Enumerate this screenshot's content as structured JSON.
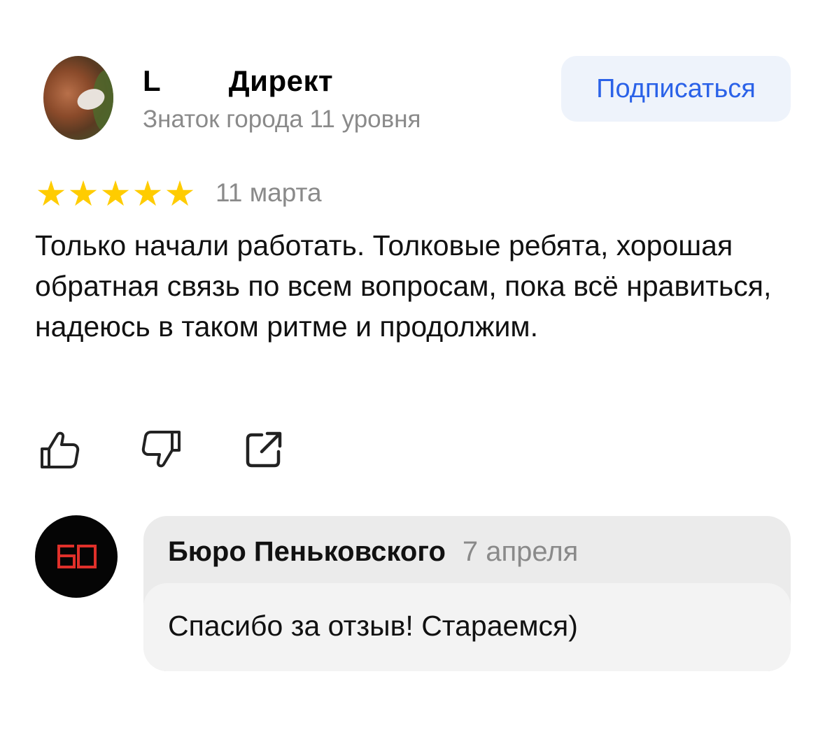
{
  "author": {
    "name": "L        Директ",
    "level": "Знаток города 11 уровня"
  },
  "subscribe_label": "Подписаться",
  "review": {
    "rating": 5,
    "rating_max": 5,
    "date": "11 марта",
    "text": "Только начали работать. Толковые ребята, хорошая обратная связь по всем вопросам, пока всё нравиться, надеюсь в таком ритме и продолжим."
  },
  "actions": [
    {
      "icon": "thumbs-up-icon"
    },
    {
      "icon": "thumbs-down-icon"
    },
    {
      "icon": "share-icon"
    }
  ],
  "reply": {
    "logo_text": "БО",
    "author": "Бюро Пеньковского",
    "date": "7 апреля",
    "text": "Спасибо за отзыв! Стараемся)"
  },
  "colors": {
    "star": "#ffcc00",
    "link": "#2b62e8",
    "button_bg": "#eef3fb",
    "muted_text": "#8a8a8a",
    "reply_bg": "#ebebeb",
    "logo_red": "#e0302a"
  }
}
